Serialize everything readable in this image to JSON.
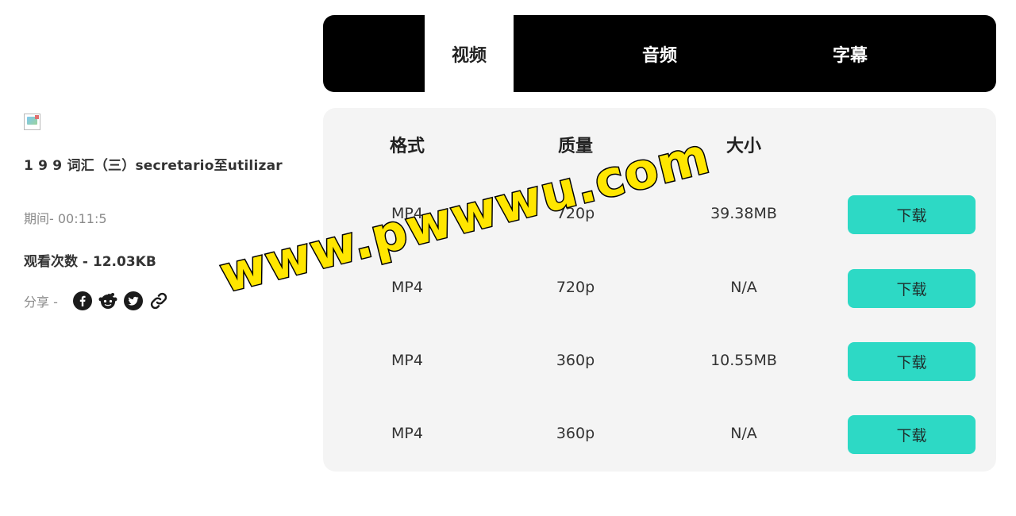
{
  "video": {
    "title": "1 9 9 词汇（三）secretario至utilizar",
    "duration": "期间-  00:11:5",
    "views": "观看次数 - 12.03KB",
    "share_label": "分享 -",
    "share_icons": [
      "facebook-icon",
      "reddit-icon",
      "twitter-icon",
      "link-icon"
    ]
  },
  "tabs": [
    {
      "label": "视频",
      "active": true
    },
    {
      "label": "音频",
      "active": false
    },
    {
      "label": "字幕",
      "active": false
    }
  ],
  "table": {
    "headers": [
      "格式",
      "质量",
      "大小"
    ],
    "rows": [
      {
        "format": "MP4",
        "quality": "720p",
        "size": "39.38MB",
        "action": "下载"
      },
      {
        "format": "MP4",
        "quality": "720p",
        "size": "N/A",
        "action": "下载"
      },
      {
        "format": "MP4",
        "quality": "360p",
        "size": "10.55MB",
        "action": "下载"
      },
      {
        "format": "MP4",
        "quality": "360p",
        "size": "N/A",
        "action": "下载"
      }
    ]
  },
  "watermark": "www.pwwwu.com",
  "colors": {
    "tab_bar": "#000000",
    "panel": "#f4f4f4",
    "download_button": "#2dd9c5",
    "watermark_fill": "#ffe600"
  }
}
